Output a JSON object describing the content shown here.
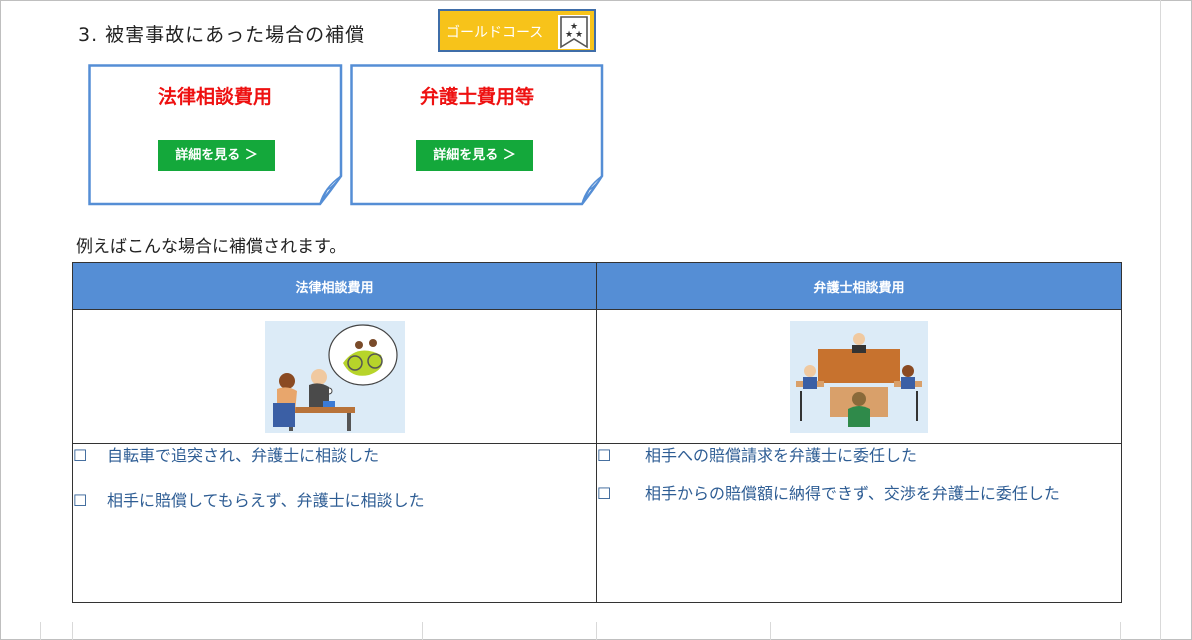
{
  "section": {
    "title": "3. 被害事故にあった場合の補償"
  },
  "badge": {
    "label": "ゴールドコース",
    "icon": "bookmark-stars-icon",
    "color": "#f7c31a"
  },
  "cards": [
    {
      "title": "法律相談費用",
      "button_label": "詳細を見る ＞"
    },
    {
      "title": "弁護士費用等",
      "button_label": "詳細を見る ＞"
    }
  ],
  "examples": {
    "heading": "例えばこんな場合に補償されます。",
    "columns": [
      {
        "header": "法律相談費用",
        "illustration": "consultation-illustration",
        "items": [
          "自転車で追突され、弁護士に相談した",
          "相手に賠償してもらえず、弁護士に相談した"
        ]
      },
      {
        "header": "弁護士相談費用",
        "illustration": "courtroom-illustration",
        "items": [
          "相手への賠償請求を弁護士に委任した",
          "相手からの賠償額に納得できず、交渉を弁護士に委任した"
        ]
      }
    ]
  },
  "colors": {
    "header_blue": "#558ed5",
    "button_green": "#14a83b",
    "title_red": "#ee1111",
    "list_blue": "#2e5d94"
  }
}
